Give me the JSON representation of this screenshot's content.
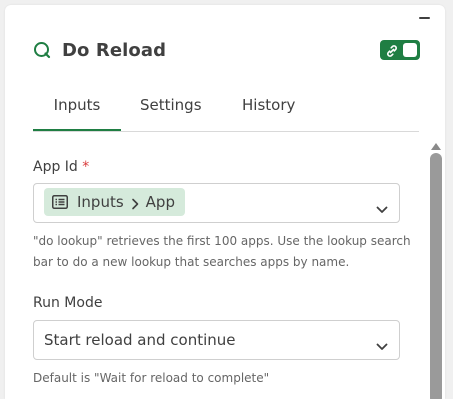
{
  "header": {
    "title": "Do Reload"
  },
  "tabs": [
    {
      "label": "Inputs",
      "active": true
    },
    {
      "label": "Settings",
      "active": false
    },
    {
      "label": "History",
      "active": false
    }
  ],
  "app_id": {
    "label": "App Id",
    "required_mark": "*",
    "chip_path": [
      "Inputs",
      "App"
    ],
    "help": "\"do lookup\" retrieves the first 100 apps. Use the lookup search bar to do a new lookup that searches apps by name."
  },
  "run_mode": {
    "label": "Run Mode",
    "value": "Start reload and continue",
    "help": "Default is \"Wait for reload to complete\""
  },
  "colors": {
    "accent": "#1f7e43",
    "chip_bg": "#d5eadb",
    "required": "#d93b3b"
  },
  "icons": {
    "header": "qlik-q-icon",
    "toggle": "link-icon",
    "chip": "list-icon",
    "separator": "chevron-right-icon",
    "dropdown": "chevron-down-icon"
  }
}
